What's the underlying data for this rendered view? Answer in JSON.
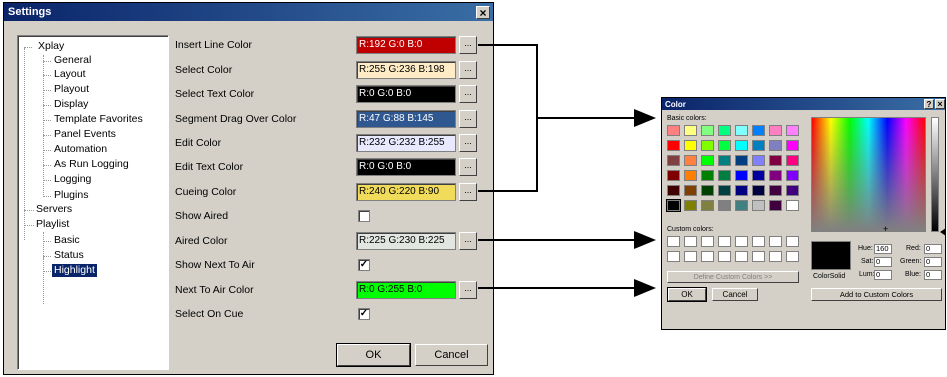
{
  "settings": {
    "title": "Settings",
    "close": "×",
    "tree": {
      "xplay": "Xplay",
      "general": "General",
      "layout": "Layout",
      "playout": "Playout",
      "display": "Display",
      "template_favorites": "Template Favorites",
      "panel_events": "Panel Events",
      "automation": "Automation",
      "as_run_logging": "As Run Logging",
      "logging": "Logging",
      "plugins": "Plugins",
      "servers": "Servers",
      "playlist": "Playlist",
      "basic": "Basic",
      "status": "Status",
      "highlight": "Highlight"
    },
    "rows": {
      "insert_line_color": {
        "label": "Insert Line Color",
        "value": "R:192 G:0 B:0",
        "bg": "#c00000",
        "fg": "#ffffff"
      },
      "select_color": {
        "label": "Select Color",
        "value": "R:255 G:236 B:198",
        "bg": "#ffecc6",
        "fg": "#000000"
      },
      "select_text_color": {
        "label": "Select Text Color",
        "value": "R:0 G:0 B:0",
        "bg": "#000000",
        "fg": "#ffffff"
      },
      "segment_drag_over_color": {
        "label": "Segment Drag Over Color",
        "value": "R:47 G:88 B:145",
        "bg": "#2f5891",
        "fg": "#ffffff"
      },
      "edit_color": {
        "label": "Edit Color",
        "value": "R:232 G:232 B:255",
        "bg": "#e8e8ff",
        "fg": "#000000"
      },
      "edit_text_color": {
        "label": "Edit Text Color",
        "value": "R:0 G:0 B:0",
        "bg": "#000000",
        "fg": "#ffffff"
      },
      "cueing_color": {
        "label": "Cueing Color",
        "value": "R:240 G:220 B:90",
        "bg": "#f0dc5a",
        "fg": "#000000"
      },
      "show_aired": {
        "label": "Show Aired",
        "checked": ""
      },
      "aired_color": {
        "label": "Aired Color",
        "value": "R:225 G:230 B:225",
        "bg": "#e1e6e1",
        "fg": "#000000"
      },
      "show_next_to_air": {
        "label": "Show Next To Air",
        "checked": "✓"
      },
      "next_to_air_color": {
        "label": "Next To Air Color",
        "value": "R:0 G:255 B:0",
        "bg": "#00ff00",
        "fg": "#000000"
      },
      "select_on_cue": {
        "label": "Select On Cue",
        "checked": "✓"
      }
    },
    "dots_label": "...",
    "ok": "OK",
    "cancel": "Cancel"
  },
  "color_dialog": {
    "title": "Color",
    "help": "?",
    "close": "×",
    "basic_colors_label": "Basic colors:",
    "custom_colors_label": "Custom colors:",
    "define_custom": "Define Custom Colors >>",
    "ok": "OK",
    "cancel": "Cancel",
    "color_solid": "Color|Solid",
    "hue_label": "Hue:",
    "hue": "160",
    "sat_label": "Sat:",
    "sat": "0",
    "lum_label": "Lum:",
    "lum": "0",
    "red_label": "Red:",
    "red": "0",
    "green_label": "Green:",
    "green": "0",
    "blue_label": "Blue:",
    "blue": "0",
    "add_custom": "Add to Custom Colors",
    "basic_colors": [
      "#ff8080",
      "#ffff80",
      "#80ff80",
      "#00ff80",
      "#80ffff",
      "#0080ff",
      "#ff80c0",
      "#ff80ff",
      "#ff0000",
      "#ffff00",
      "#80ff00",
      "#00ff40",
      "#00ffff",
      "#0080c0",
      "#8080c0",
      "#ff00ff",
      "#804040",
      "#ff8040",
      "#00ff00",
      "#008080",
      "#004080",
      "#8080ff",
      "#800040",
      "#ff0080",
      "#800000",
      "#ff8000",
      "#008000",
      "#008040",
      "#0000ff",
      "#0000a0",
      "#800080",
      "#8000ff",
      "#400000",
      "#804000",
      "#004000",
      "#004040",
      "#000080",
      "#000040",
      "#400040",
      "#400080",
      "#000000",
      "#808000",
      "#808040",
      "#808080",
      "#408080",
      "#c0c0c0",
      "#400040",
      "#ffffff"
    ]
  }
}
